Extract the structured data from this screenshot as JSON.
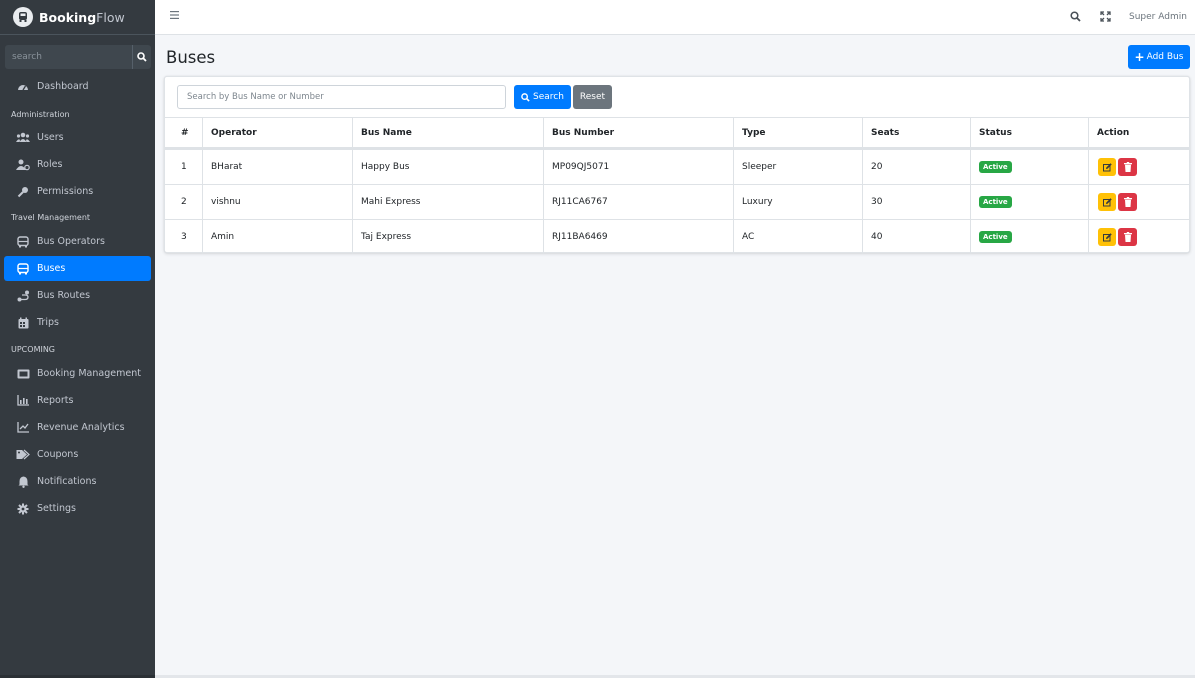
{
  "brand": {
    "name_bold": "Booking",
    "name_light": "Flow"
  },
  "sidebar": {
    "search_placeholder": "search",
    "sections": [
      {
        "header": "",
        "items": [
          {
            "label": "Dashboard",
            "icon": "dashboard-icon"
          }
        ]
      },
      {
        "header": "Administration",
        "items": [
          {
            "label": "Users",
            "icon": "users-icon"
          },
          {
            "label": "Roles",
            "icon": "roles-icon"
          },
          {
            "label": "Permissions",
            "icon": "key-icon"
          }
        ]
      },
      {
        "header": "Travel Management",
        "items": [
          {
            "label": "Bus Operators",
            "icon": "bus-icon"
          },
          {
            "label": "Buses",
            "icon": "bus-icon",
            "active": true
          },
          {
            "label": "Bus Routes",
            "icon": "route-icon"
          },
          {
            "label": "Trips",
            "icon": "calendar-icon"
          }
        ]
      },
      {
        "header": "UPCOMING",
        "items": [
          {
            "label": "Booking Management",
            "icon": "ticket-icon"
          },
          {
            "label": "Reports",
            "icon": "chart-bar-icon"
          },
          {
            "label": "Revenue Analytics",
            "icon": "chart-line-icon"
          },
          {
            "label": "Coupons",
            "icon": "tags-icon"
          },
          {
            "label": "Notifications",
            "icon": "bell-icon"
          },
          {
            "label": "Settings",
            "icon": "gear-icon"
          }
        ]
      }
    ]
  },
  "topbar": {
    "user": "Super Admin"
  },
  "page": {
    "title": "Buses",
    "add_button": "Add Bus"
  },
  "filter": {
    "search_placeholder": "Search by Bus Name or Number",
    "search_button": "Search",
    "reset_button": "Reset"
  },
  "table": {
    "columns": [
      "#",
      "Operator",
      "Bus Name",
      "Bus Number",
      "Type",
      "Seats",
      "Status",
      "Action"
    ],
    "rows": [
      {
        "num": "1",
        "operator": "BHarat",
        "bus_name": "Happy Bus",
        "bus_number": "MP09QJ5071",
        "type": "Sleeper",
        "seats": "20",
        "status": "Active"
      },
      {
        "num": "2",
        "operator": "vishnu",
        "bus_name": "Mahi Express",
        "bus_number": "RJ11CA6767",
        "type": "Luxury",
        "seats": "30",
        "status": "Active"
      },
      {
        "num": "3",
        "operator": "Amin",
        "bus_name": "Taj Express",
        "bus_number": "RJ11BA6469",
        "type": "AC",
        "seats": "40",
        "status": "Active"
      }
    ]
  },
  "colors": {
    "primary": "#007bff",
    "sidebar": "#343a40",
    "success": "#28a745",
    "warning": "#ffc107",
    "danger": "#dc3545",
    "secondary": "#6c757d"
  }
}
